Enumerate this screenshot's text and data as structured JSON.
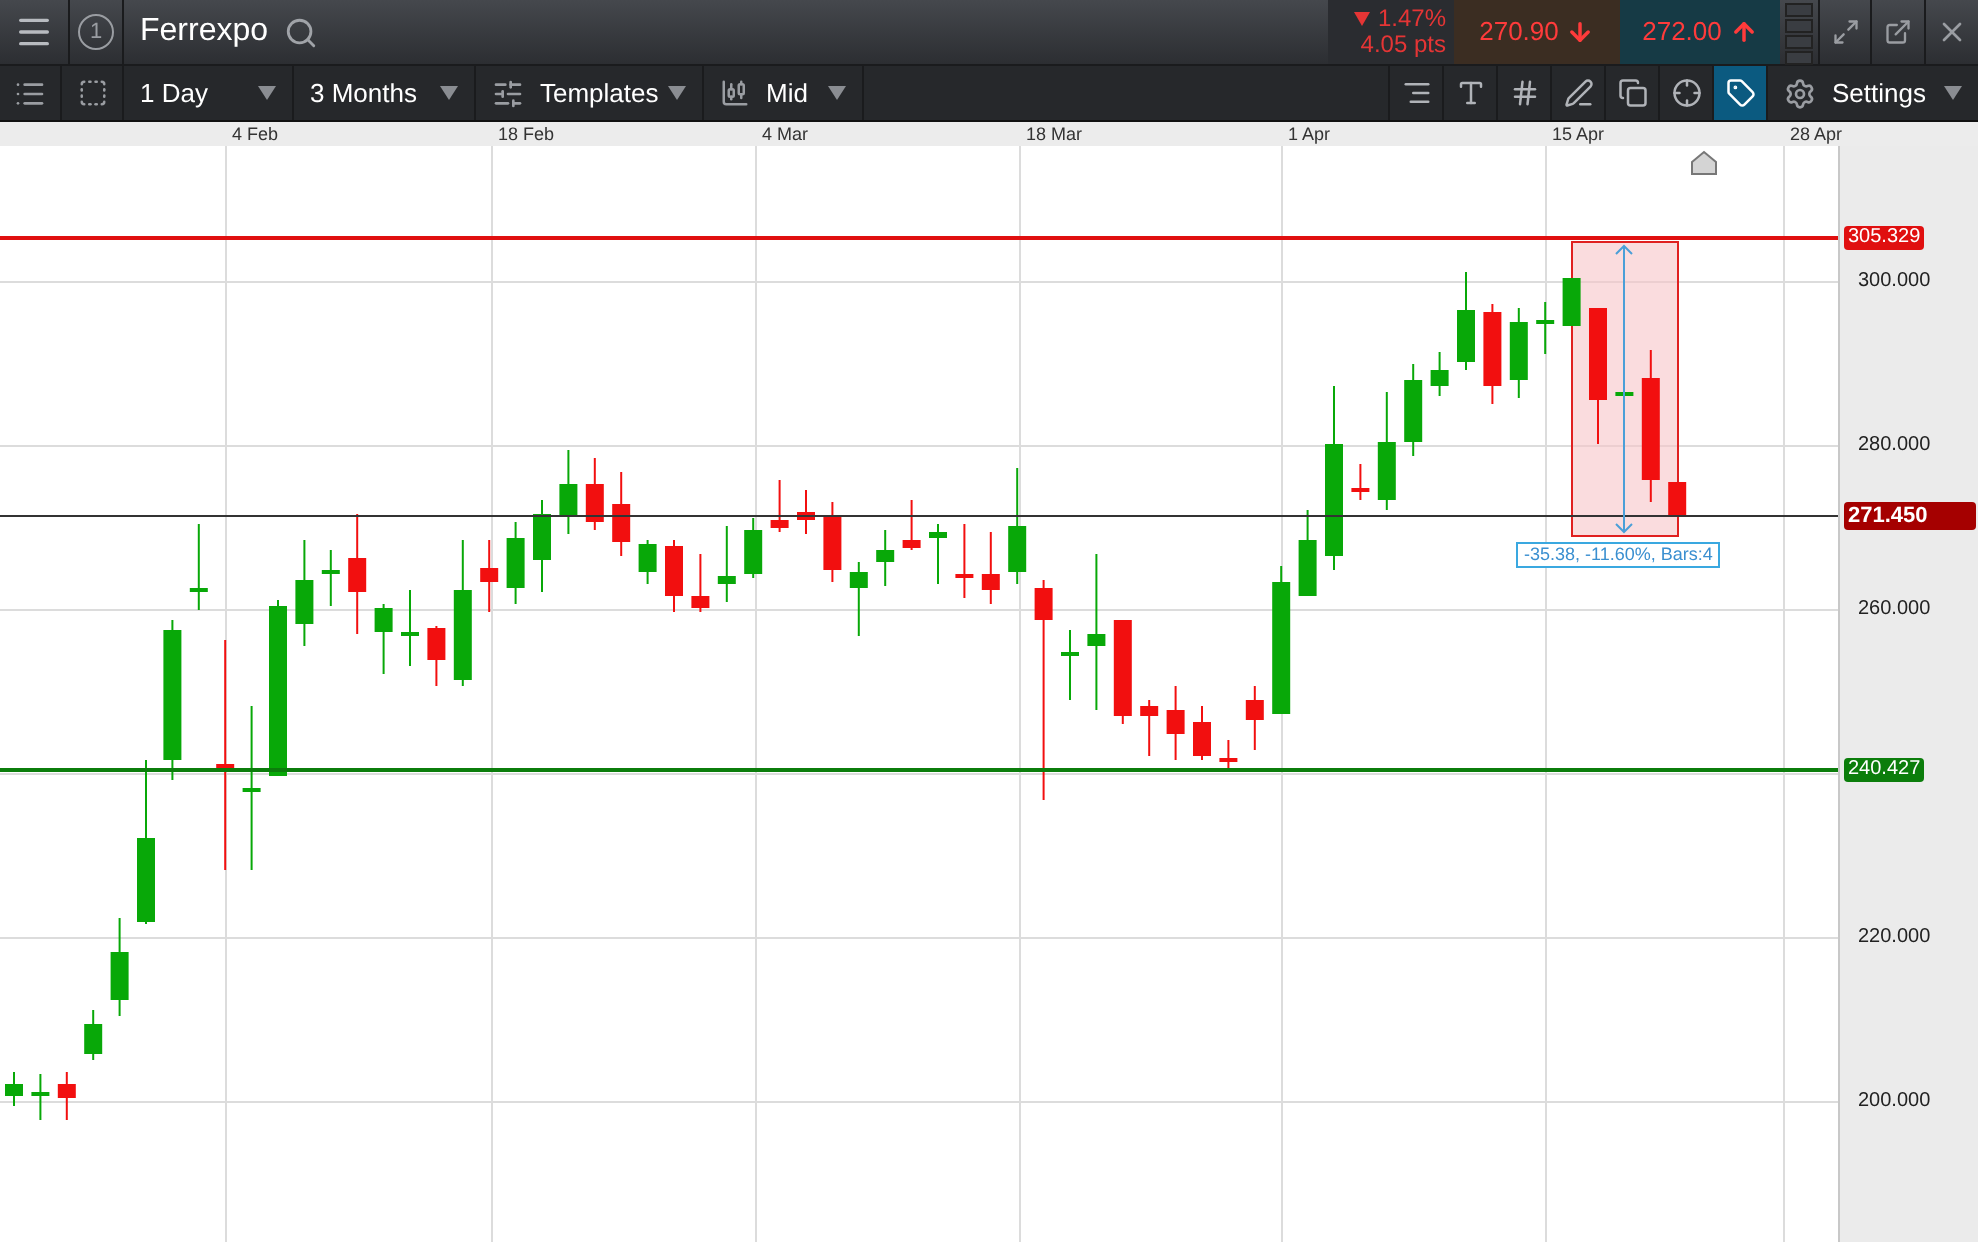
{
  "window": {
    "badge": "1",
    "instrument": "Ferrexpo"
  },
  "quote": {
    "change_percent": "1.47%",
    "change_points": "4.05 pts",
    "sell": "270.90",
    "buy": "272.00"
  },
  "toolbar": {
    "interval": "1 Day",
    "range": "3 Months",
    "templates": "Templates",
    "price_type": "Mid",
    "settings": "Settings",
    "tools": [
      {
        "kind": "axis",
        "selected": false
      },
      {
        "kind": "text",
        "selected": false
      },
      {
        "kind": "grid",
        "selected": false
      },
      {
        "kind": "draw",
        "selected": false
      },
      {
        "kind": "windows",
        "selected": false
      },
      {
        "kind": "crosshair",
        "selected": false
      },
      {
        "kind": "tag",
        "selected": true
      }
    ]
  },
  "x_axis": {
    "labels": [
      "4 Feb",
      "18 Feb",
      "4 Mar",
      "18 Mar",
      "1 Apr",
      "15 Apr",
      "28 Apr"
    ]
  },
  "y_axis": {
    "labels": [
      "300.000",
      "280.000",
      "260.000",
      "220.000",
      "200.000"
    ]
  },
  "levels": [
    {
      "kind": "resistance",
      "label": "305.329",
      "color": "#e00f0f"
    },
    {
      "kind": "last",
      "label": "271.450",
      "color": "#a50000"
    },
    {
      "kind": "support",
      "label": "240.427",
      "color": "#0b7d0b"
    }
  ],
  "measurement": {
    "label": "-35.38, -11.60%, Bars:4"
  }
}
